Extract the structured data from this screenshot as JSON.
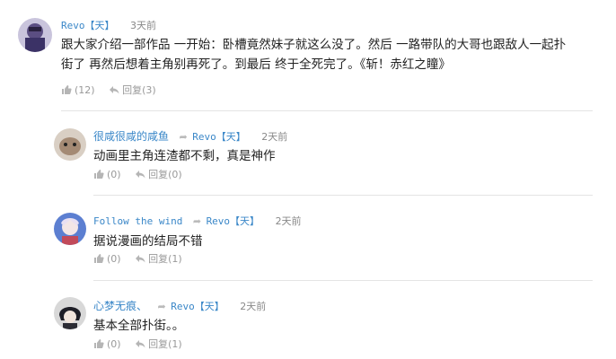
{
  "comments": [
    {
      "user": "Revo【天】",
      "time": "3天前",
      "text_line1": "跟大家介绍一部作品 一开始：卧槽竟然妹子就这么没了。然后 一路带队的大哥也跟敌人一起扑",
      "text_line2": "街了 再然后想着主角别再死了。到最后 终于全死完了。《斩！赤红之瞳》",
      "likes": "(12)",
      "reply_label": "回复(3)"
    },
    {
      "user": "很咸很咸的咸鱼",
      "reply_to": "Revo【天】",
      "time": "2天前",
      "text": "动画里主角连渣都不剩，真是神作",
      "likes": "(0)",
      "reply_label": "回复(0)"
    },
    {
      "user": "Follow the wind",
      "reply_to": "Revo【天】",
      "time": "2天前",
      "text": "据说漫画的结局不错",
      "likes": "(0)",
      "reply_label": "回复(1)"
    },
    {
      "user": "心梦无痕、",
      "reply_to": "Revo【天】",
      "time": "2天前",
      "text": "基本全部扑街。。",
      "likes": "(0)",
      "reply_label": "回复(1)"
    }
  ],
  "colors": {
    "link": "#3a87c8",
    "muted": "#999999",
    "divider": "#e4e4e4"
  }
}
